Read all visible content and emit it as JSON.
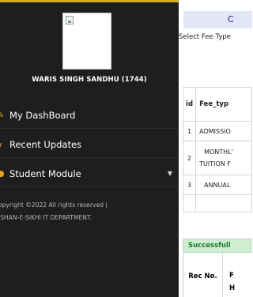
{
  "user": {
    "name": "WARIS SINGH SANDHU (1744)"
  },
  "menu": [
    {
      "label": "My DashBoard",
      "icon": "pencil-icon"
    },
    {
      "label": "Recent Updates",
      "icon": "bolt-icon"
    },
    {
      "label": "Student Module",
      "icon": "circle-icon"
    }
  ],
  "footer": {
    "line1": "opyright ©2022 All rights reserved |",
    "line2": "ISHAN-E-SIKHI IT DEPARTMENT."
  },
  "main": {
    "header": "C",
    "fee_type_label": "Select Fee Type",
    "table": {
      "headers": [
        "id",
        "Fee_typ"
      ],
      "rows": [
        {
          "id": "1",
          "type_line1": "ADMISSIO",
          "type_line2": ""
        },
        {
          "id": "2",
          "type_line1": "MONTHL'",
          "type_line2": "TUITION F"
        },
        {
          "id": "3",
          "type_line1": "ANNUAL",
          "type_line2": ""
        }
      ]
    },
    "success": {
      "title": "Successfull",
      "col1": "Rec No.",
      "col2_line1": "F",
      "col2_line2": "H"
    }
  },
  "colors": {
    "sidebar": "#1e1e1e",
    "accent": "#e5a21a",
    "header_bg": "#e3e6f6"
  }
}
